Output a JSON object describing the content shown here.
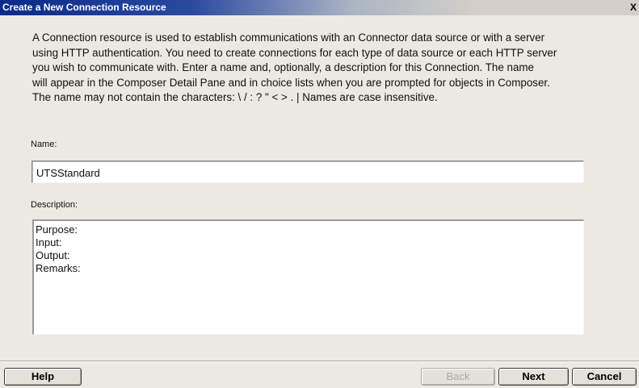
{
  "window": {
    "title": "Create a New Connection Resource",
    "close_glyph": "X"
  },
  "intro": {
    "lines": [
      "A Connection resource is used to establish communications with an Connector data source or with a server",
      "using HTTP authentication. You need to create connections for each type of data source or each HTTP server",
      "you wish to communicate with.  Enter a name and, optionally, a description for this Connection.  The name",
      "will appear in the Composer Detail Pane and in choice lists when you are prompted for objects in Composer.",
      " The name may not contain the characters: \\ / : ? \" < > . |  Names are case insensitive."
    ]
  },
  "form": {
    "name_label": "Name:",
    "name_value": "UTSStandard",
    "description_label": "Description:",
    "description_lines": [
      "Purpose:",
      "Input:",
      "Output:",
      "Remarks:"
    ]
  },
  "buttons": {
    "help": "Help",
    "back": "Back",
    "next": "Next",
    "cancel": "Cancel"
  }
}
